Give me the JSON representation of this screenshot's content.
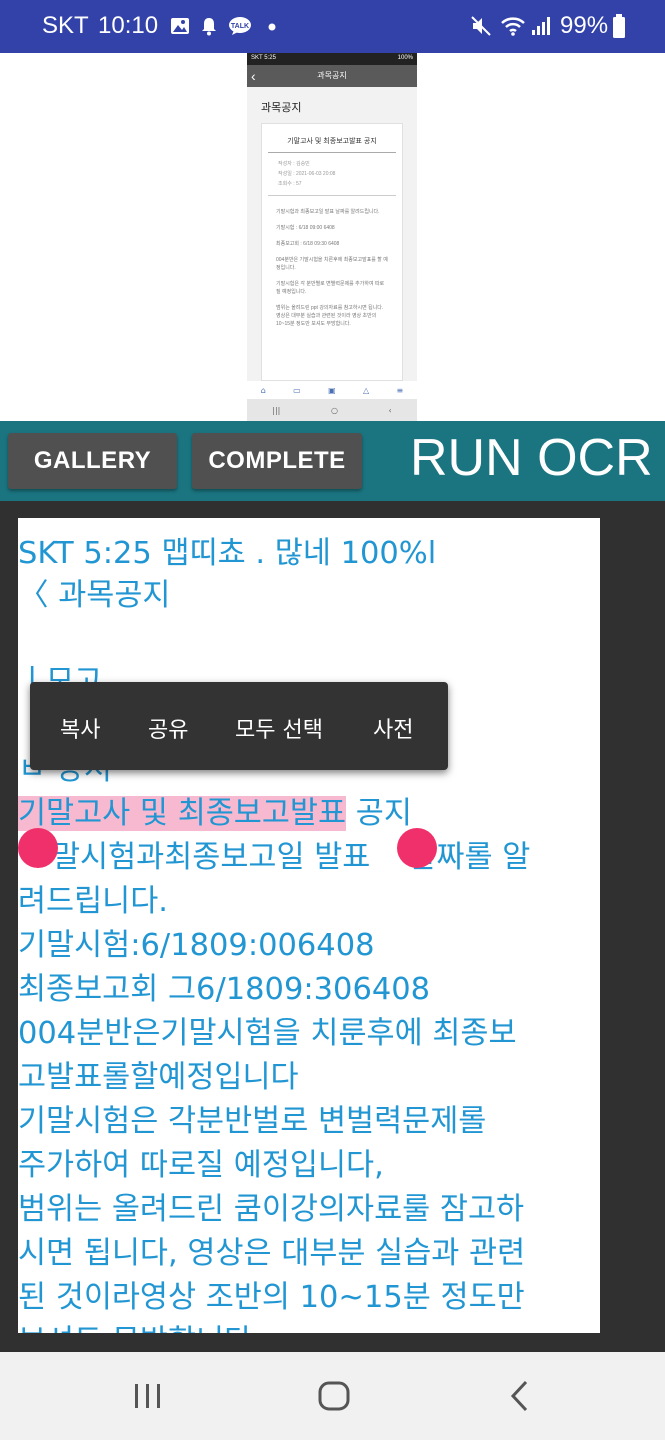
{
  "status_bar": {
    "carrier": "SKT",
    "time": "10:10",
    "battery": "99%",
    "icons": [
      "gallery-icon",
      "notification-bell-icon",
      "talk-icon",
      "dot-icon",
      "mute-icon",
      "wifi-icon",
      "signal-icon",
      "battery-icon"
    ],
    "talk_label": "TALK"
  },
  "preview": {
    "status": "SKT 5:25",
    "battery": "100%",
    "header_title": "과목공지",
    "page_title": "과목공지",
    "card_title": "기말고사 및 최종보고발표 공지",
    "meta": [
      "작성자 : 김승민",
      "작성일 : 2021-06-03 20:08",
      "조회수 : 57"
    ],
    "body": [
      "기말시험과 최종보고일 발표 날짜를 알려드립니다.",
      "기말시험 : 6/18 09:00 6408",
      "최종보고회 : 6/18 09:30 6408",
      "004분반은 기말시험을 치른후에 최종보고발표를 할 예정입니다.",
      "기말시험은 각 분반별로 변별력문제를 추가하여 따로질 예정입니다.",
      "범위는 올려드린 ppt 강의자료를 참고하시면 됩니다. 영상은 대부분 실습과 관련된 것이라 영상 초반의 10~15분 정도만 보셔도 무방합니다."
    ]
  },
  "toolbar": {
    "gallery_label": "GALLERY",
    "complete_label": "COMPLETE",
    "run_ocr_label": "RUN OCR"
  },
  "ocr": {
    "lines": [
      "SKT 5:25 맵띠쵸 . 많네 100%l",
      "〈 과목공지",
      "",
      "ㅣ모고",
      "",
      "ㅂ    당서",
      "기말고사 및 최종보고발표",
      "공지",
      "말시험과최종보고일 발표",
      "날짜롤 알",
      "려드립니다.",
      "기말시험:6/1809:006408",
      "최종보고회 그6/1809:306408",
      "004분반은기말시험을 치룬후에 최종보",
      "고발표롤할예정입니다",
      "기말시험은 각분반벌로 변벌력문제롤",
      "주가하여 따로질 예정입니다,",
      "범위는 올려드린 쿰이강의자료룰 잠고하",
      "시면 됩니다, 영상은 대부분 실습과 관련",
      "된 것이라영상 조반의 10~15분 정도만",
      "보셔도 무방합니다"
    ]
  },
  "context_menu": {
    "items": [
      "복사",
      "공유",
      "모두 선택",
      "사전"
    ]
  },
  "nav_bar": {
    "icons": [
      "recent-apps-icon",
      "home-icon",
      "back-icon"
    ]
  },
  "colors": {
    "status_bar": "#3242a8",
    "toolbar": "#1a7580",
    "ocr_text": "#2196d3",
    "highlight": "#f7b9cf",
    "handle": "#f0306a"
  }
}
